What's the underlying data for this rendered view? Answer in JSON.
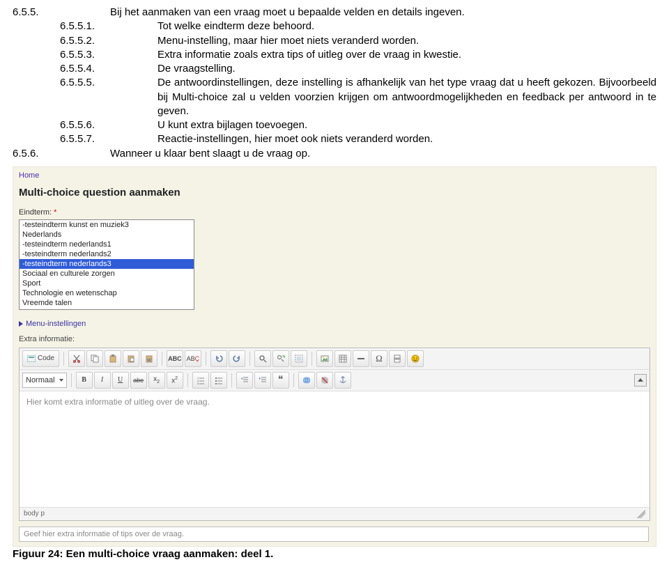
{
  "doc": {
    "items": [
      {
        "num": "6.5.5.",
        "deep": false,
        "text": "Bij het aanmaken van een vraag moet u bepaalde velden en details ingeven."
      },
      {
        "num": "6.5.5.1.",
        "deep": true,
        "text": "Tot welke eindterm deze behoord."
      },
      {
        "num": "6.5.5.2.",
        "deep": true,
        "text": "Menu-instelling, maar hier moet niets veranderd worden."
      },
      {
        "num": "6.5.5.3.",
        "deep": true,
        "text": "Extra informatie zoals extra tips of uitleg over de vraag in kwestie."
      },
      {
        "num": "6.5.5.4.",
        "deep": true,
        "text": "De vraagstelling."
      },
      {
        "num": "6.5.5.5.",
        "deep": true,
        "text": "De antwoordinstellingen, deze instelling is afhankelijk van het type vraag dat u heeft gekozen. Bijvoorbeeld bij Multi-choice zal u velden voorzien krijgen om antwoordmogelijkheden en feedback per antwoord in te geven."
      },
      {
        "num": "6.5.5.6.",
        "deep": true,
        "text": "U kunt extra bijlagen toevoegen."
      },
      {
        "num": "6.5.5.7.",
        "deep": true,
        "text": "Reactie-instellingen, hier moet ook niets veranderd worden."
      },
      {
        "num": "6.5.6.",
        "deep": false,
        "text": "Wanneer u klaar bent slaagt u de vraag op."
      }
    ]
  },
  "app": {
    "home": "Home",
    "title": "Multi-choice question aanmaken",
    "eindterm_label": "Eindterm:",
    "options": [
      {
        "label": "-testeindterm kunst en muziek3",
        "selected": false
      },
      {
        "label": "Nederlands",
        "selected": false
      },
      {
        "label": "-testeindterm nederlands1",
        "selected": false
      },
      {
        "label": "-testeindterm nederlands2",
        "selected": false
      },
      {
        "label": "-testeindterm nederlands3",
        "selected": true
      },
      {
        "label": "Sociaal en culturele zorgen",
        "selected": false
      },
      {
        "label": "Sport",
        "selected": false
      },
      {
        "label": "Technologie en wetenschap",
        "selected": false
      },
      {
        "label": "Vreemde talen",
        "selected": false
      }
    ],
    "menu_inst": "Menu-instellingen",
    "extra_label": "Extra informatie:",
    "editor": {
      "code_label": "Code",
      "style": "Normaal",
      "placeholder": "Hier komt extra informatie of uitleg over de vraag.",
      "path": "body p"
    },
    "hint_placeholder": "Geef hier extra informatie of tips over de vraag."
  },
  "caption": "Figuur 24: Een multi-choice vraag aanmaken: deel 1."
}
